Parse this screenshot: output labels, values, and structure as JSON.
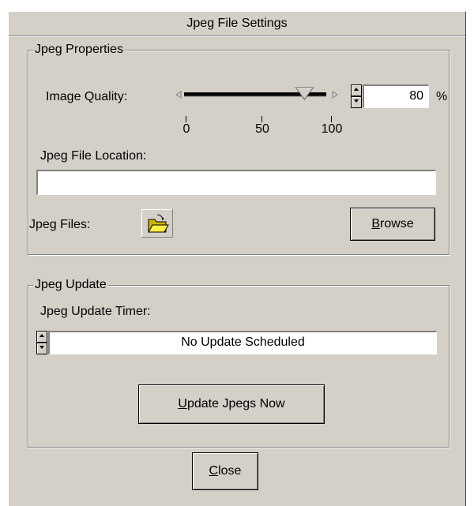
{
  "window": {
    "title": "Jpeg File Settings"
  },
  "properties": {
    "legend": "Jpeg Properties",
    "quality_label": "Image Quality:",
    "quality_value": "80",
    "quality_unit": "%",
    "slider": {
      "min": 0,
      "max": 100,
      "value": 80,
      "ticks": [
        "0",
        "50",
        "100"
      ]
    },
    "location_label": "Jpeg File Location:",
    "location_value": "",
    "files_label": "Jpeg Files:",
    "browse_accel": "B",
    "browse_rest": "rowse"
  },
  "update": {
    "legend": "Jpeg Update",
    "timer_label": "Jpeg Update Timer:",
    "timer_value": "No Update Scheduled",
    "update_accel": "U",
    "update_rest": "pdate Jpegs Now"
  },
  "close_accel": "C",
  "close_rest": "lose",
  "icons": {
    "folder": "open-folder-icon"
  }
}
